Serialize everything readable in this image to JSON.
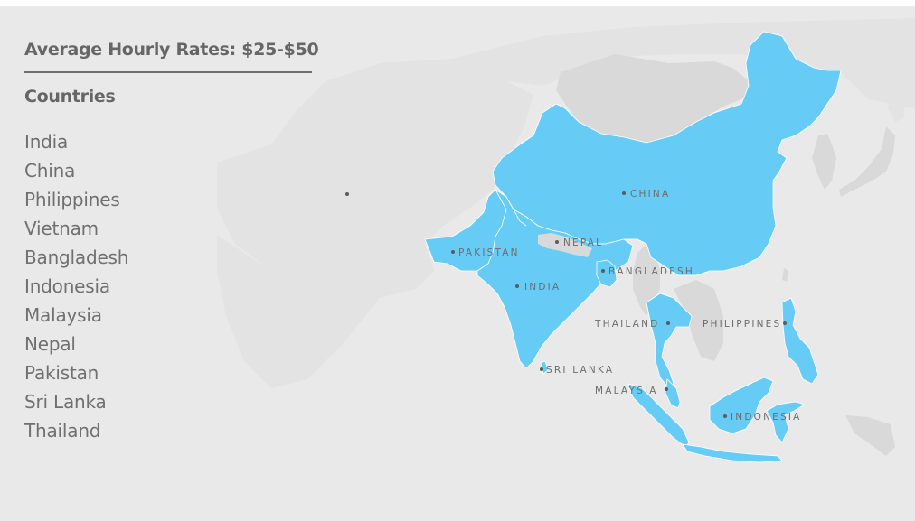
{
  "header": {
    "title": "Average Hourly Rates: $25-$50"
  },
  "countries_section": {
    "heading": "Countries",
    "items": [
      "India",
      "China",
      "Philippines",
      "Vietnam",
      "Bangladesh",
      "Indonesia",
      "Malaysia",
      "Nepal",
      "Pakistan",
      "Sri Lanka",
      "Thailand"
    ]
  },
  "map": {
    "highlight_color": "#66ccf5",
    "labels": {
      "china": "CHINA",
      "nepal": "NEPAL",
      "pakistan": "PAKISTAN",
      "bangladesh": "BANGLADESH",
      "india": "INDIA",
      "thailand": "THAILAND",
      "philippines": "PHILIPPINES",
      "sri_lanka": "SRI LANKA",
      "malaysia": "MALAYSIA",
      "indonesia": "INDONESIA"
    }
  }
}
